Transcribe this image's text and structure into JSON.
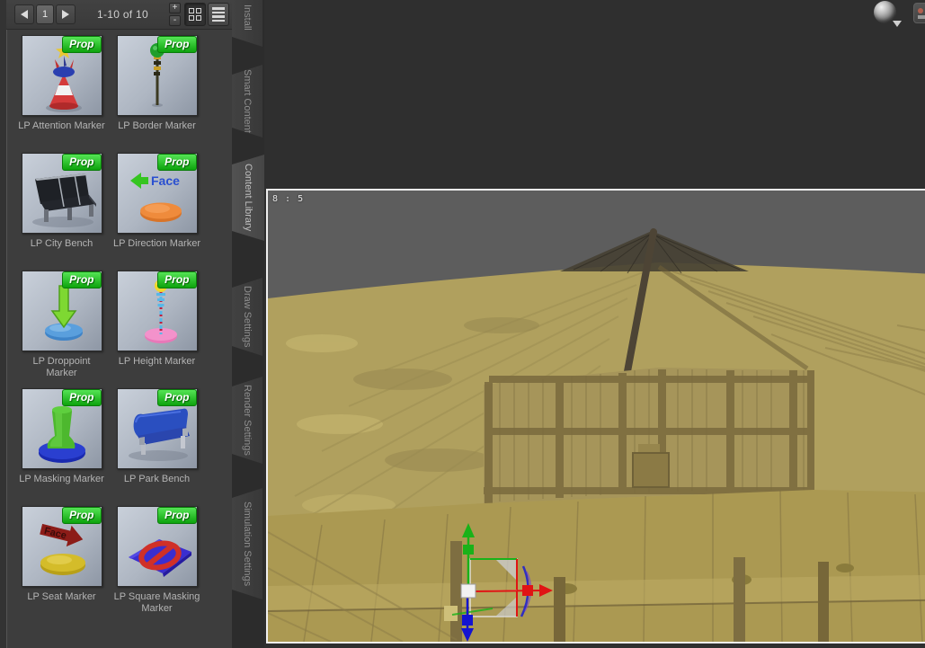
{
  "toolbar": {
    "page": "1",
    "range_label": "1-10 of 10",
    "stepper_plus": "+",
    "stepper_minus": "-"
  },
  "tabs": [
    {
      "label": "Install",
      "active": false
    },
    {
      "label": "Smart Content",
      "active": false
    },
    {
      "label": "Content Library",
      "active": true
    },
    {
      "label": "Draw Settings",
      "active": false
    },
    {
      "label": "Render Settings",
      "active": false
    },
    {
      "label": "Simulation Settings",
      "active": false
    }
  ],
  "library": {
    "badge": "Prop",
    "items": [
      {
        "label": "LP Attention Marker"
      },
      {
        "label": "LP Border Marker"
      },
      {
        "label": "LP City Bench"
      },
      {
        "label": "LP Direction Marker",
        "thumb_text": "Face"
      },
      {
        "label": "LP Droppoint Marker"
      },
      {
        "label": "LP Height Marker"
      },
      {
        "label": "LP Masking Marker"
      },
      {
        "label": "LP Park Bench"
      },
      {
        "label": "LP Seat Marker",
        "thumb_text": "Face"
      },
      {
        "label": "LP Square Masking Marker"
      }
    ]
  },
  "viewport": {
    "aspect_label": "8 : 5"
  },
  "colors": {
    "badge_green": "#19c119",
    "panel_bg": "#3d3d3d",
    "tab_active_bg": "#4b4b4b",
    "viewport_bg": "#2f2f2f",
    "sky_gray": "#5d5d5d",
    "thatch_tan": "#b0a05e",
    "beam_brown": "#7c6c3f",
    "frame_border": "#efefef",
    "gizmo_x_red": "#e01414",
    "gizmo_y_green": "#19b219",
    "gizmo_z_blue": "#1414d0"
  }
}
